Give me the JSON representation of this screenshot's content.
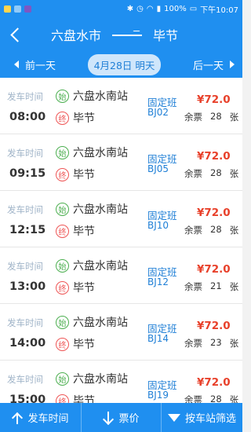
{
  "status_bar": {
    "battery": "100%",
    "time": "下午10:07"
  },
  "nav": {
    "from": "六盘水市",
    "to": "毕节"
  },
  "date_bar": {
    "prev_label": "前一天",
    "current_label": "4月28日 明天",
    "next_label": "后一天"
  },
  "trips": [
    {
      "depart_label": "发车时间",
      "time": "08:00",
      "start_badge": "始",
      "start_station": "六盘水南站",
      "end_badge": "终",
      "end_station": "毕节",
      "type": "固定班",
      "bus_no": "BJ02",
      "price": "¥72.0",
      "seats_label": "余票",
      "seats": "28",
      "seats_unit": "张"
    },
    {
      "depart_label": "发车时间",
      "time": "09:15",
      "start_badge": "始",
      "start_station": "六盘水南站",
      "end_badge": "终",
      "end_station": "毕节",
      "type": "固定班",
      "bus_no": "BJ05",
      "price": "¥72.0",
      "seats_label": "余票",
      "seats": "28",
      "seats_unit": "张"
    },
    {
      "depart_label": "发车时间",
      "time": "12:15",
      "start_badge": "始",
      "start_station": "六盘水南站",
      "end_badge": "终",
      "end_station": "毕节",
      "type": "固定班",
      "bus_no": "BJ10",
      "price": "¥72.0",
      "seats_label": "余票",
      "seats": "28",
      "seats_unit": "张"
    },
    {
      "depart_label": "发车时间",
      "time": "13:00",
      "start_badge": "始",
      "start_station": "六盘水南站",
      "end_badge": "终",
      "end_station": "毕节",
      "type": "固定班",
      "bus_no": "BJ12",
      "price": "¥72.0",
      "seats_label": "余票",
      "seats": "21",
      "seats_unit": "张"
    },
    {
      "depart_label": "发车时间",
      "time": "14:00",
      "start_badge": "始",
      "start_station": "六盘水南站",
      "end_badge": "终",
      "end_station": "毕节",
      "type": "固定班",
      "bus_no": "BJ14",
      "price": "¥72.0",
      "seats_label": "余票",
      "seats": "23",
      "seats_unit": "张"
    },
    {
      "depart_label": "发车时间",
      "time": "15:00",
      "start_badge": "始",
      "start_station": "六盘水南站",
      "end_badge": "终",
      "end_station": "毕节",
      "type": "固定班",
      "bus_no": "BJ19",
      "price": "¥72.0",
      "seats_label": "余票",
      "seats": "28",
      "seats_unit": "张"
    }
  ],
  "bottom_bar": {
    "sort_time_label": "发车时间",
    "sort_price_label": "票价",
    "filter_label": "按车站筛选"
  },
  "colors": {
    "primary": "#1f8ff0",
    "price": "#e8412b",
    "start_badge": "#4caf50",
    "end_badge": "#e55555"
  }
}
